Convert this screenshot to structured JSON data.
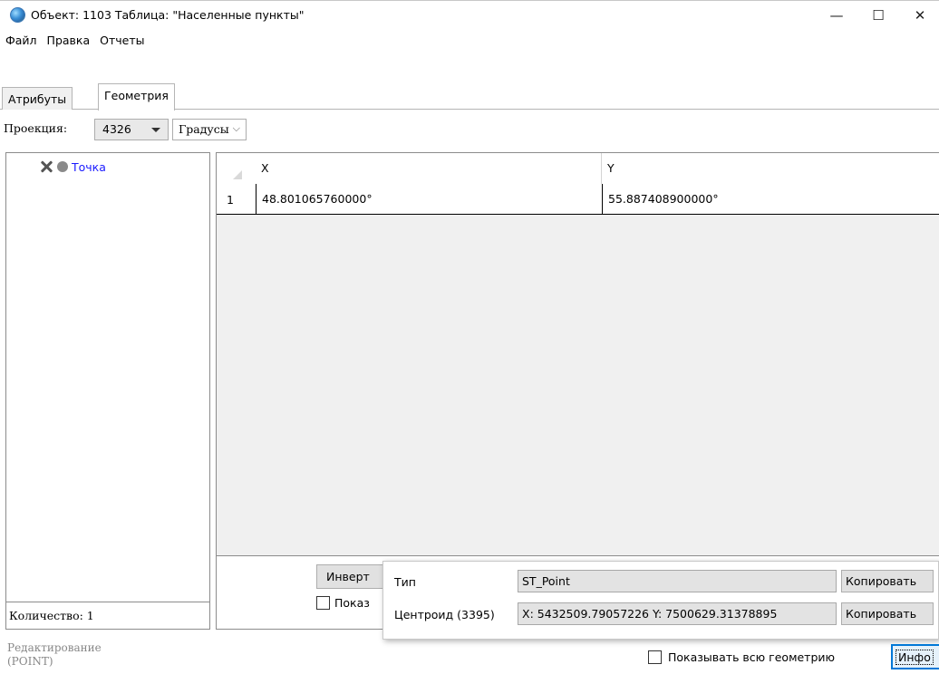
{
  "window": {
    "title": "Объект: 1103 Таблица: \"Населенные пункты\"",
    "minimize": "—",
    "maximize": "☐",
    "close": "✕"
  },
  "menu": {
    "file": "Файл",
    "edit": "Правка",
    "reports": "Отчеты"
  },
  "tabs": {
    "attributes": "Атрибуты",
    "geometry": "Геометрия"
  },
  "projection": {
    "label": "Проекция:",
    "srid": "4326",
    "units": "Градусы"
  },
  "tree": {
    "item_label": "Точка",
    "count": "Количество: 1"
  },
  "grid": {
    "columns": [
      "X",
      "Y"
    ],
    "rows": [
      {
        "num": "1",
        "x": "48.801065760000°",
        "y": "55.887408900000°"
      }
    ]
  },
  "grid_bottom": {
    "invert_label": "Инверт",
    "show_label": "Показ"
  },
  "popup": {
    "type_label": "Тип",
    "type_value": "ST_Point",
    "centroid_label": "Центроид (3395)",
    "centroid_value": "X: 5432509.79057226 Y: 7500629.31378895",
    "copy_label": "Копировать"
  },
  "status": {
    "mode_line1": "Редактирование",
    "mode_line2": "(POINT)",
    "show_all_label": "Показывать всю геометрию",
    "info_label": "Инфо"
  }
}
